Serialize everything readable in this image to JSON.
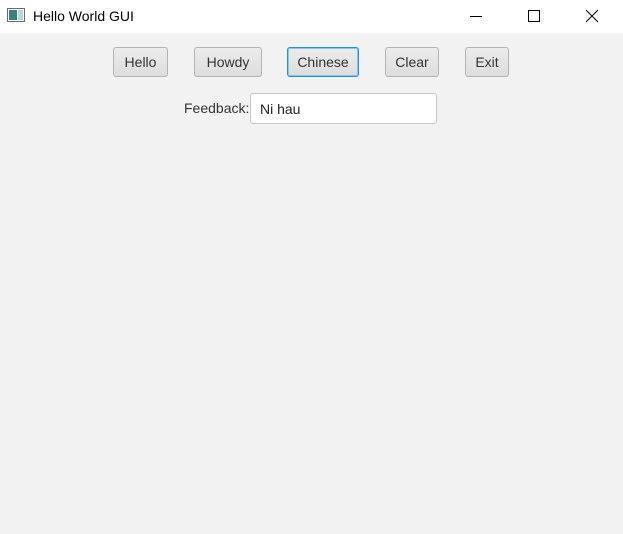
{
  "window": {
    "title": "Hello World GUI",
    "icon": "java-app-icon",
    "controls": [
      "minimize-icon",
      "maximize-icon",
      "close-icon"
    ]
  },
  "buttons": {
    "hello": "Hello",
    "howdy": "Howdy",
    "chinese": "Chinese",
    "clear": "Clear",
    "exit": "Exit"
  },
  "feedback": {
    "label": "Feedback:",
    "value": "Ni hau"
  },
  "colors": {
    "focus_border": "#1f93d7",
    "window_background": "#f2f2f2"
  }
}
